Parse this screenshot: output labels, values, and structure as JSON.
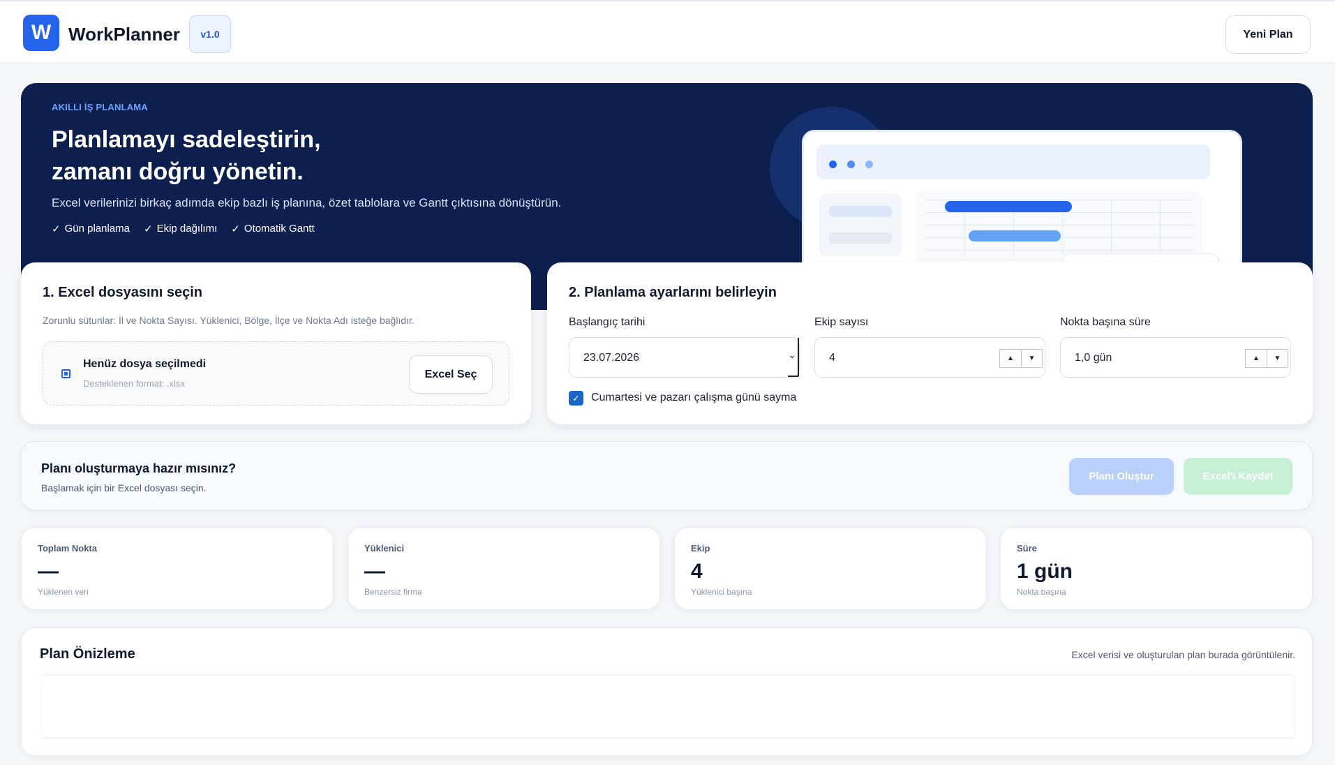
{
  "app": {
    "logo_letter": "W",
    "name": "WorkPlanner",
    "version": "v1.0",
    "new_plan_label": "Yeni Plan",
    "accent_color": "#2563eb"
  },
  "hero": {
    "eyebrow": "AKILLI İŞ PLANLAMA",
    "title_line1": "Planlamayı sadeleştirin,",
    "title_line2": "zamanı doğru yönetin.",
    "subtitle": "Excel verilerinizi birkaç adımda ekip bazlı iş planına, özet tablolara ve Gantt çıktısına dönüştürün.",
    "features": [
      "Gün planlama",
      "Ekip dağılımı",
      "Otomatik Gantt"
    ],
    "check_glyph": "✓",
    "background_color": "#0d1f4f"
  },
  "upload_card": {
    "title": "1. Excel dosyasını seçin",
    "description": "Zorunlu sütunlar: İl ve Nokta Sayısı. Yüklenici, Bölge, İlçe ve Nokta Adı isteğe bağlıdır.",
    "file_status": "Henüz dosya seçilmedi",
    "file_hint": "Desteklenen format: .xlsx",
    "select_button": "Excel Seç",
    "file_icon": "file-icon"
  },
  "settings_card": {
    "title": "2. Planlama ayarlarını belirleyin",
    "start_date_label": "Başlangıç tarihi",
    "start_date_value": "23.07.2026",
    "team_count_label": "Ekip sayısı",
    "team_count_value": "4",
    "duration_label": "Nokta başına süre",
    "duration_value": "1,0 gün",
    "weekend_label": "Cumartesi ve pazarı çalışma günü sayma",
    "weekend_checked": true
  },
  "ready_card": {
    "title": "Planı oluşturmaya hazır mısınız?",
    "subtitle": "Başlamak için bir Excel dosyası seçin.",
    "create_button": "Planı Oluştur",
    "save_button": "Excel'i Kaydet"
  },
  "stats": [
    {
      "label": "Toplam Nokta",
      "value": "—",
      "sub": "Yüklenen veri"
    },
    {
      "label": "Yüklenici",
      "value": "—",
      "sub": "Benzersiz firma"
    },
    {
      "label": "Ekip",
      "value": "4",
      "sub": "Yüklenici başına"
    },
    {
      "label": "Süre",
      "value": "1 gün",
      "sub": "Nokta başına"
    }
  ],
  "preview": {
    "title": "Plan Önizleme",
    "note": "Excel verisi ve oluşturulan plan burada görüntülenir."
  }
}
